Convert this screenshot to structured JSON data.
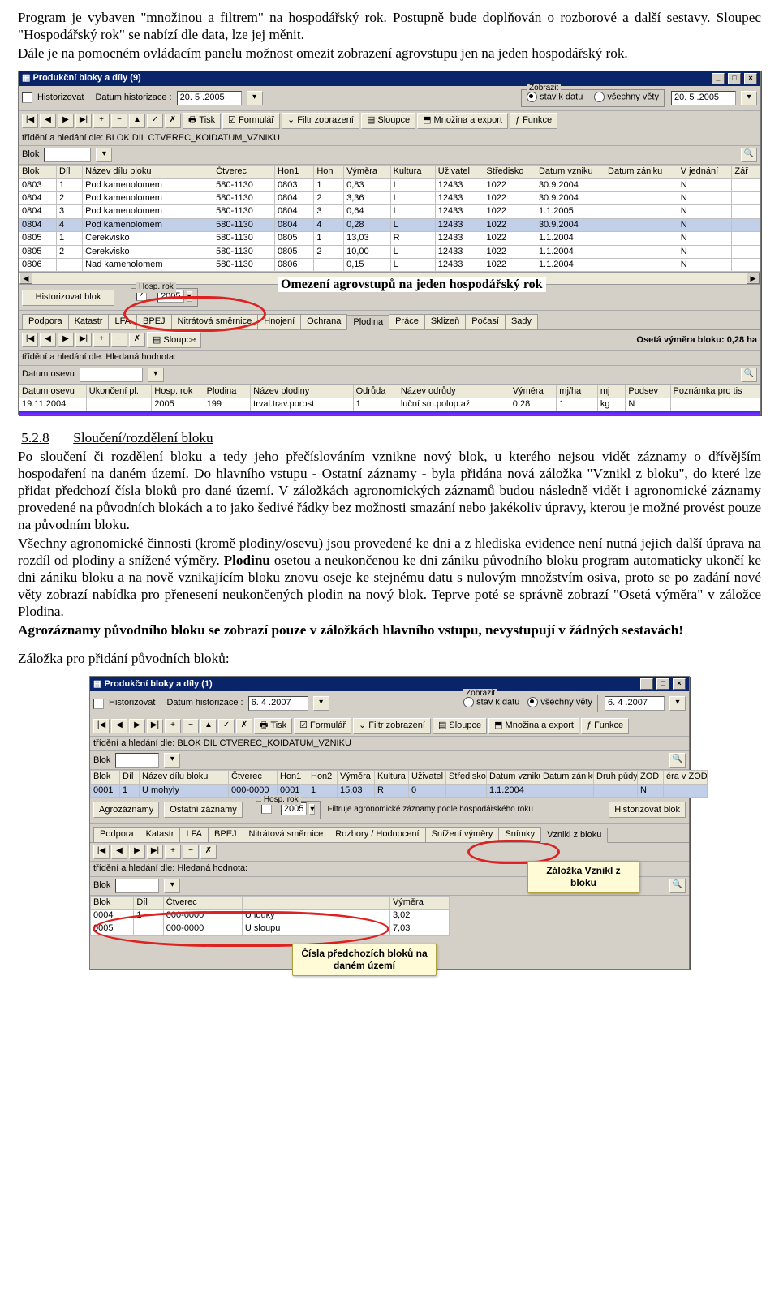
{
  "intro": {
    "p1a": "Program je vybaven \"množinou a filtrem\" na hospodářský rok. Postupně bude doplňován o rozborové a další sestavy. Sloupec \"Hospodářský rok\" se nabízí dle data, lze jej měnit.",
    "p1b": "Dále je na pomocném ovládacím panelu možnost omezit zobrazení agrovstupu jen na jeden hospodářský rok."
  },
  "shot1": {
    "title": "Produkční bloky a díly (9)",
    "historizovat": "Historizovat",
    "datum_hist_label": "Datum historizace :",
    "datum_hist_value": "20. 5 .2005",
    "zobrazit_legend": "Zobrazit",
    "opt_stav": "stav k datu",
    "opt_vsechny": "všechny věty",
    "zobrazit_date": "20. 5 .2005",
    "tb": {
      "tisk": "Tisk",
      "formular": "Formulář",
      "filtr": "Filtr zobrazení",
      "sloupce": "Sloupce",
      "mnozina": "Množina a export",
      "funkce": "Funkce"
    },
    "sort_label": "třídění a hledání dle: BLOK  DIL  CTVEREC_KOIDATUM_VZNIKU",
    "blok_label": "Blok",
    "headers": [
      "Blok",
      "Díl",
      "Název dílu bloku",
      "Čtverec",
      "Hon1",
      "Hon",
      "Výměra",
      "Kultura",
      "Uživatel",
      "Středisko",
      "Datum vzniku",
      "Datum zániku",
      "V jednání",
      "Zář"
    ],
    "rows": [
      [
        "0803",
        "1",
        "Pod kamenolomem",
        "580-1130",
        "0803",
        "1",
        "0,83",
        "L",
        "12433",
        "1022",
        "30.9.2004",
        "",
        "N",
        ""
      ],
      [
        "0804",
        "2",
        "Pod kamenolomem",
        "580-1130",
        "0804",
        "2",
        "3,36",
        "L",
        "12433",
        "1022",
        "30.9.2004",
        "",
        "N",
        ""
      ],
      [
        "0804",
        "3",
        "Pod kamenolomem",
        "580-1130",
        "0804",
        "3",
        "0,64",
        "L",
        "12433",
        "1022",
        "1.1.2005",
        "",
        "N",
        ""
      ],
      [
        "0804",
        "4",
        "Pod kamenolomem",
        "580-1130",
        "0804",
        "4",
        "0,28",
        "L",
        "12433",
        "1022",
        "30.9.2004",
        "",
        "N",
        ""
      ],
      [
        "0805",
        "1",
        "Cerekvisko",
        "580-1130",
        "0805",
        "1",
        "13,03",
        "R",
        "12433",
        "1022",
        "1.1.2004",
        "",
        "N",
        ""
      ],
      [
        "0805",
        "2",
        "Cerekvisko",
        "580-1130",
        "0805",
        "2",
        "10,00",
        "L",
        "12433",
        "1022",
        "1.1.2004",
        "",
        "N",
        ""
      ],
      [
        "0806",
        "",
        "Nad kamenolomem",
        "580-1130",
        "0806",
        "",
        "0,15",
        "L",
        "12433",
        "1022",
        "1.1.2004",
        "",
        "N",
        ""
      ]
    ],
    "callout_agr": "Omezení agrovstupů na jeden hospodářský rok",
    "hist_blok": "Historizovat blok",
    "hosp_rok_label": "Hosp. rok",
    "hosp_rok_value": "2005",
    "tabs": [
      "Podpora",
      "Katastr",
      "LFA",
      "BPEJ",
      "Nitrátová směrnice",
      "Hnojení",
      "Ochrana",
      "Plodina",
      "Práce",
      "Sklizeň",
      "Počasí",
      "Sady"
    ],
    "oseta": "Osetá výměra bloku: 0,28 ha",
    "sort2": "třídění a hledání dle: Hledaná hodnota:",
    "datum_osevu_label": "Datum osevu",
    "sub_headers": [
      "Datum osevu",
      "Ukončení pl.",
      "Hosp. rok",
      "Plodina",
      "Název plodiny",
      "Odrůda",
      "Název odrůdy",
      "Výměra",
      "mj/ha",
      "mj",
      "Podsev",
      "Poznámka pro tis"
    ],
    "sub_row": [
      "19.11.2004",
      "",
      "2005",
      "199",
      "trval.trav.porost",
      "1",
      "luční sm.polop.až",
      "0,28",
      "1",
      "kg",
      "N",
      ""
    ]
  },
  "section": {
    "num": "5.2.8",
    "title": "Sloučení/rozdělení bloku",
    "p1": "Po sloučení či rozdělení bloku a tedy jeho přečíslováním vznikne nový blok, u kterého nejsou vidět záznamy o dřívějším hospodaření na daném území. Do hlavního vstupu - Ostatní záznamy - byla přidána nová záložka \"Vznikl z bloku\", do které lze přidat předchozí čísla bloků pro dané území. V záložkách agronomických záznamů budou následně vidět i agronomické záznamy provedené na původních blokách a to jako šedivé řádky bez možnosti smazání nebo jakékoliv úpravy, kterou je možné provést pouze na původním bloku.",
    "p2a": "Všechny agronomické činnosti (kromě plodiny/osevu) jsou provedené ke dni a z hlediska evidence není nutná jejich další úprava na rozdíl od plodiny a snížené výměry. ",
    "p2b": "Plodinu",
    "p2c": " osetou a neukončenou ke dni zániku původního bloku program automaticky ukončí ke dni zániku bloku a na nově vznikajícím bloku znovu oseje ke stejnému datu s nulovým množstvím osiva, proto se po zadání nové věty zobrazí nabídka pro přenesení neukončených plodin na nový blok. Teprve poté se správně zobrazí \"Osetá výměra\" v záložce Plodina.",
    "p3": "Agrozáznamy původního bloku se zobrazí pouze v záložkách hlavního vstupu, nevystupují v žádných sestavách!",
    "p4": "Záložka pro přidání původních bloků:"
  },
  "shot2": {
    "title": "Produkční bloky a díly (1)",
    "historizovat": "Historizovat",
    "datum_hist_label": "Datum historizace :",
    "datum_hist_value": "6. 4 .2007",
    "zobrazit_legend": "Zobrazit",
    "opt_stav": "stav k datu",
    "opt_vsechny": "všechny věty",
    "zobrazit_date": "6. 4 .2007",
    "tb": {
      "tisk": "Tisk",
      "formular": "Formulář",
      "filtr": "Filtr zobrazení",
      "sloupce": "Sloupce",
      "mnozina": "Množina a export",
      "funkce": "Funkce"
    },
    "sort_label": "třídění a hledání dle: BLOK  DIL  CTVEREC_KOIDATUM_VZNIKU",
    "blok_label": "Blok",
    "headers": [
      "Blok",
      "Díl",
      "Název dílu bloku",
      "Čtverec",
      "Hon1",
      "Hon2",
      "Výměra",
      "Kultura",
      "Uživatel",
      "Středisko",
      "Datum vzniku",
      "Datum zániku",
      "Druh půdy",
      "ZOD",
      "éra v ZOD"
    ],
    "row": [
      "0001",
      "1",
      "U mohyly",
      "000-0000",
      "0001",
      "1",
      "15,03",
      "R",
      "0",
      "",
      "1.1.2004",
      "",
      "",
      "N",
      ""
    ],
    "agrozaznamy": "Agrozáznamy",
    "ost_zaznamy": "Ostatní záznamy",
    "hosp_rok_label": "Hosp. rok",
    "hosp_rok_value": "2005",
    "filtr_msg": "Filtruje agronomické záznamy podle hospodářského roku",
    "hist_blok": "Historizovat blok",
    "tabs": [
      "Podpora",
      "Katastr",
      "LFA",
      "BPEJ",
      "Nitrátová směrnice",
      "Rozbory / Hodnocení",
      "Snížení výměry",
      "Snímky",
      "Vznikl z bloku"
    ],
    "sort2": "třídění a hledání dle: Hledaná hodnota:",
    "sub_blok": "Blok",
    "sub_headers": [
      "Blok",
      "Díl",
      "Čtverec",
      "",
      "Výměra"
    ],
    "sub_rows": [
      [
        "0004",
        "1",
        "000-0000",
        "U louky",
        "3,02"
      ],
      [
        "0005",
        "",
        "000-0000",
        "U sloupu",
        "7,03"
      ]
    ],
    "callout_tab": "Záložka Vznikl z bloku",
    "callout_rows": "Čísla předchozích bloků na daném území"
  }
}
